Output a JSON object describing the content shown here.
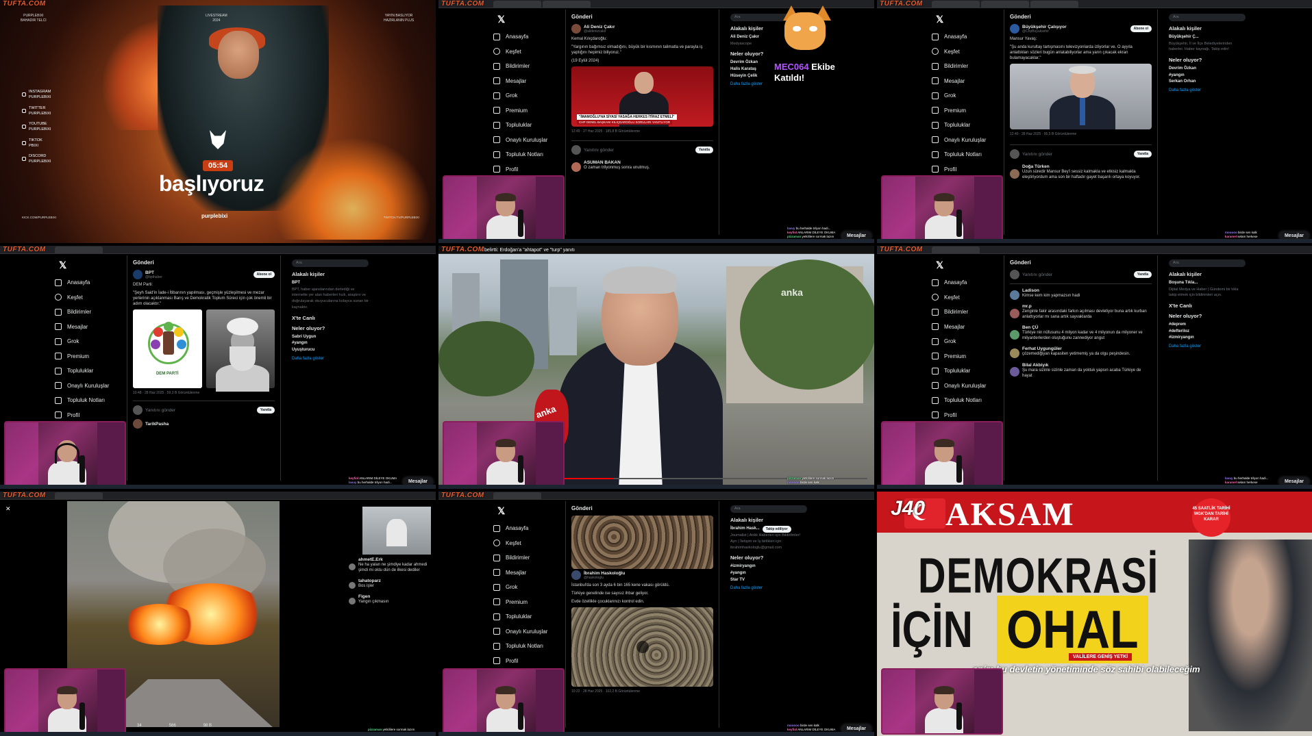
{
  "watermark": "TUFTA.COM",
  "tile1": {
    "top_left": "PURPLEBIXI\nBAHADIR TELCI",
    "top_mid": "LIVESTREAM\n2024",
    "top_right": "YAYIN BASLIYOR\nHAZIRLANIN PLUS",
    "socials": [
      {
        "icon": "instagram-icon",
        "label": "INSTAGRAM\nPURPLEBIXI"
      },
      {
        "icon": "twitter-icon",
        "label": "TWITTER\nPURPLEBIXI"
      },
      {
        "icon": "youtube-icon",
        "label": "YOUTUBE\nPURPLEBIXI"
      },
      {
        "icon": "tiktok-icon",
        "label": "TIKTOK\nPBIXI"
      },
      {
        "icon": "discord-icon",
        "label": "DISCORD\nPURPLEBIXI"
      }
    ],
    "timer": "05:54",
    "title": "başlıyoruz",
    "brand": "purplebixi",
    "bottom_left": "KICK.COM/PURPLEBIXI",
    "bottom_right": "TWITCH.TV/PURPLEBIXI"
  },
  "x_nav": [
    "Anasayfa",
    "Keşfet",
    "Bildirimler",
    "Mesajlar",
    "Grok",
    "Premium",
    "Topluluklar",
    "Onaylı Kuruluşlar",
    "Topluluk Notları",
    "Profil"
  ],
  "x_nav_icons": [
    "home-icon",
    "search-icon",
    "bell-icon",
    "mail-icon",
    "grok-icon",
    "x-premium-icon",
    "communities-icon",
    "verified-orgs-icon",
    "notes-icon",
    "profile-icon"
  ],
  "common": {
    "header": "Gönderi",
    "search": "Ara",
    "related": "Alakalı kişiler",
    "whats_happening": "Neler oluyor?",
    "reply": "Yanıtını gönder",
    "reply_btn": "Yanıtla",
    "messages": "Mesajlar",
    "follow": "Takip ediliyor",
    "subscribe": "Abone ol",
    "x_trend": "X'te Canlı",
    "show_more": "Daha fazla göster"
  },
  "tile2": {
    "author": "Ali Deniz Çakır",
    "handle": "@alidenizcakir",
    "lines": [
      "Kemal Kılıçdaroğlu:",
      "\"Yargının bağımsız olmadığını, büyük bir kısmının talimatla ve parayla iş yaptığını hepimiz biliyoruz.\"",
      "(19 Eylül 2024)"
    ],
    "caption1": "\"İMAMOĞLU'NA SİYASİ YASAĞA HERKES İTİRAZ ETMELİ\"",
    "caption2": "CHP GENEL BAŞKANI KILIÇDAROĞLU SORULARI YANITLIYOR",
    "meta": "12:49 · 27 Haz 2025 · 185,8 B Görüntülenme",
    "related_name": "Ali Deniz Çakır",
    "related_sub": "Medyascope",
    "trends": [
      "Devrim Özkan",
      "Halis Karataş",
      "Hüseyin Çelik"
    ],
    "next_author": "ASUMAN BAKAN",
    "next_text": "O zaman trilyonmuş sonra unutmuş.",
    "banner1": "MEC064",
    "banner2": "Ekibe",
    "banner3": "Katıldı!"
  },
  "tile3": {
    "author": "Büyükşehir Çalışıyor",
    "handle": "@ChpBuyuksehir",
    "lines": [
      "Mansur Yavaş:",
      "\"Şu anda kurultay tartışmasını televizyonlarda izliyorlar ve. O ayyıla anlattıkları sözleri bugün anlatabiliyorlar ama yarın çıkacak ekran bulamayacaklar.\""
    ],
    "meta": "12:40 · 28 Haz 2025 · 95,5 B Görüntülenme",
    "related_name": "Büyükşehir Ç...",
    "related_desc": "Büyükşehir, İl ve İlçe Belediyelerinden haberler. Haber kaynağı. Takip edin!",
    "trends": [
      "Devrim Özkan",
      "#yangın",
      "Serkan Orhan"
    ],
    "reply_author": "Doğa Türken",
    "reply_text": "Uzun süredir Mansur Bey'i sessiz kalmakla ve etkisiz kalmakla eleştiriyordum ama son bir haftadır gayet başarılı ortaya koyuyor."
  },
  "tile4": {
    "author": "BPT",
    "handle": "@bpthaber",
    "lines": [
      "DEM Parti:",
      "\"Şeyh Said'in İade-i İtibarının yapılması, geçmişle yüzleşilmesi ve mezar yerlerinin açıklanması Barış ve Demokratik Toplum Süreci için çok önemli bir adım olacaktır.\""
    ],
    "logo_label": "DEM PARTİ",
    "meta": "10:48 · 28 Haz 2025 · 59,3 B Görüntülenme",
    "related_name": "BPT",
    "related_desc": "BPT, haber ajanslarından derlediği ve internette yer alan haberleri hızlı, araştırır ve doğrulayarak okuyucularına kolayca sunan bir kaynaktır.",
    "trends": [
      "Sabri Uygun",
      "#yangın",
      "Uyuşturucu"
    ],
    "next_author": "TarikPasha"
  },
  "tile5": {
    "title": "…belirtti: Erdoğan'a \"ahtapot\" ve \"turp\" yanıtı",
    "logo": "anka"
  },
  "tile6": {
    "posts": [
      {
        "author": "Ladison",
        "text": "Kimse kem kim yapmazsın hadi"
      },
      {
        "author": "mr.p",
        "text": "Zenginle fakir arasındaki farkın açılması devletiyor buna artık kurban anlattıyorlar mı sana artık sayvaklarda"
      },
      {
        "author": "Ben ÇÜ",
        "text": "Türkiye nin nüfusunu 4 milyon kadar ve 4 milyonun da milyoner ve milyarderlerden oluştuğunu zannediyor angut"
      },
      {
        "author": "Ferhat Uygungüler",
        "text": "çözemediğiyan kapasiten yetimemiş ya da olgu peşindesin."
      },
      {
        "author": "Bilal Akbiyık",
        "text": "Şu mara sizinle sizinle zaman da yoktuk yapsın acaba Türkiye de hayat"
      }
    ],
    "related_name": "Boşuna Tıkla...",
    "related_desc": "Dijital Medya ve Haber | Gündemi bir tıkla takip etmek için bildirimleri açın.",
    "trends": [
      "#deprem",
      "#defteriloz",
      "#izmiryangın"
    ]
  },
  "tile7": {
    "comments": [
      {
        "author": "ahmetE.Erk",
        "text": "Ne ha yalan ne şimdiye kadar ahmedi şimdi mi oldu dün de ilkesi dediler"
      },
      {
        "author": "tahatoparz",
        "text": "Bos işler"
      },
      {
        "author": "Figen",
        "text": "Yangın çıkmasın"
      }
    ],
    "stats": [
      "34",
      "566",
      "98 B"
    ]
  },
  "tile8": {
    "author": "İbrahim Haskoloğlu",
    "handle": "@haskologlu",
    "lines": [
      "İstanbul'da son 3 ayda 6 bin 165 kene vakası görüldü.",
      "Türkiye genelinde ise sayısız ihbar geliyor.",
      "Evde özellikle çocuklarınızı kontrol edin."
    ],
    "meta": "10:22 · 28 Haz 2025 · 102,2 B Görüntülenme",
    "related_name": "İbrahim Hask...",
    "related_desc": "Journalist | Ankk Haberleri için Bildirilmler! Ayrı | İletişim ve İş birlikleri için: ibrahimhaskologlu@gmail.com",
    "trends": [
      "#izmiryangın",
      "#yangın",
      "Star TV"
    ]
  },
  "tile9": {
    "logo": "J40",
    "paper": "AKSAM",
    "badge": "45 SAATLİK TARİHİ MGK'DAN TARİHİ KARAR",
    "headline1": "DEMOKRASİ",
    "headline2": "İÇİN",
    "headline3": "OHAL",
    "sub": "VALİLERE GENİŞ YETKİ",
    "subtitle": "enim bu devletin yönetiminde söz sahibi olabileceğim"
  },
  "chat": [
    {
      "u": "lavuy",
      "m": "bu herhalde trilyon hadi..."
    },
    {
      "u": "keyfiol",
      "m": "ANLARIM DİLEYE OKUMA"
    },
    {
      "u": "pizzaman",
      "m": "yetkililere sormak lazım"
    },
    {
      "u": "mooooo",
      "m": "birde sen kalk"
    },
    {
      "u": "karamel",
      "m": "selam herkese"
    }
  ]
}
